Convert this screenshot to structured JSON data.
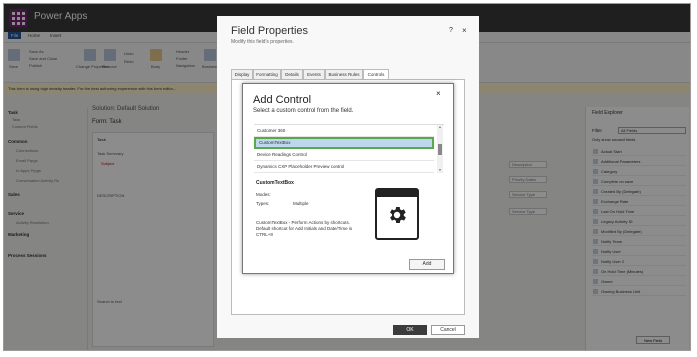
{
  "app": {
    "title": "Power Apps"
  },
  "ribbon": {
    "tabs": [
      "File",
      "Home",
      "Insert"
    ],
    "buttons": [
      "Save",
      "Save As",
      "Save and Close",
      "Publish",
      "Change Properties",
      "Remove",
      "Undo",
      "Redo",
      "Body",
      "Header",
      "Footer",
      "Navigation",
      "Business Rules"
    ]
  },
  "infobar": {
    "text": "This form is using high density header. For the best authoring experience with this form editor..."
  },
  "leftnav": {
    "items": [
      "Task",
      "Task",
      "Custom Fields",
      "Common",
      "Connections",
      "Email Prpgs",
      "In Apps Prpgs",
      "Conversation Activity Rs",
      "Sales",
      "Service",
      "Activity Resolution",
      "Marketing",
      "Process Sessions"
    ]
  },
  "form": {
    "solution": "Solution: Default Solution",
    "form_label": "Form:",
    "form_name": "Task",
    "section_label": "Task",
    "summary_label": "Task Summary",
    "subject_label": "Subject",
    "description_label": "DESCRIPTION",
    "regarding_label": "Regarding",
    "search_label": "Search to text",
    "fields": [
      "Description",
      "Priority Dates",
      "Service Type",
      "Service Type"
    ]
  },
  "field_explorer": {
    "title": "Field Explorer",
    "filter_label": "Filter",
    "filter_value": "All Fields",
    "only_unused": "Only show unused fields",
    "items": [
      "Actual Start",
      "Additional Parameters",
      "Category",
      "Complete on save",
      "Created By (Delegate)",
      "Exchange Rate",
      "Last On Hold Time",
      "Legacy Activity ID",
      "Modified By (Delegate)",
      "Notify Team",
      "Notify User",
      "Notify User 2",
      "On Hold Time (Minutes)",
      "Owner",
      "Owning Business Unit"
    ],
    "new_field": "New Field"
  },
  "field_properties": {
    "title": "Field Properties",
    "subtitle": "Modify this field's properties.",
    "help": "?",
    "close": "×",
    "tabs": [
      "Display",
      "Formatting",
      "Details",
      "Events",
      "Business Rules",
      "Controls"
    ],
    "ok": "OK",
    "cancel": "Cancel"
  },
  "add_control": {
    "title": "Add Control",
    "subtitle": "Select a custom control from the field.",
    "close": "×",
    "items": [
      "Customer 360",
      "CustomTextBox",
      "Device Readings Control",
      "Dynamics CXP Placeholder Preview control"
    ],
    "selected": "CustomTextBox",
    "detail_title": "CustomTextBox",
    "modes_label": "Modes:",
    "types_label": "Types:",
    "types_value": "Multiple",
    "description": "CustomTextBox - Perform Actions by shortcuts. Default shortcut for Add Initials and Date/Time is CTRL+8",
    "add_button": "Add",
    "icon": "gear-icon"
  },
  "colors": {
    "selection_border": "#5aa84a",
    "selection_fill": "#bdd7ee",
    "topbar": "#3b3a39",
    "waffle": "#742774"
  }
}
